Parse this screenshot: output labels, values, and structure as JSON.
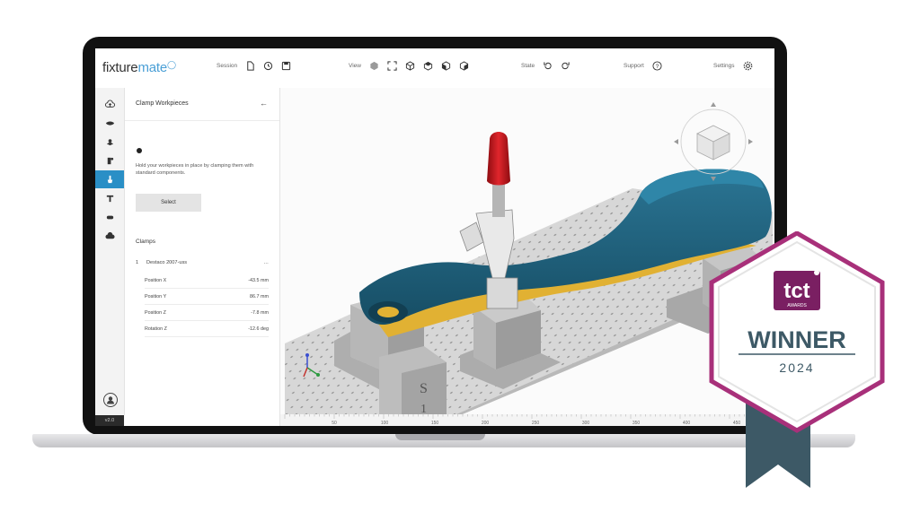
{
  "app": {
    "logo_main": "fixture",
    "logo_accent": "mate",
    "version": "v2.0"
  },
  "toolbar": {
    "session_label": "Session",
    "view_label": "View",
    "state_label": "State",
    "support_label": "Support",
    "settings_label": "Settings"
  },
  "panel": {
    "title": "Clamp Workpieces",
    "description": "Hold your workpieces in place by clamping them with standard components.",
    "select_label": "Select",
    "clamps_heading": "Clamps",
    "clamp": {
      "index": "1",
      "name": "Destaco 2007-uss",
      "more": "…"
    },
    "properties": [
      {
        "label": "Position X",
        "value": "-43.5 mm"
      },
      {
        "label": "Position Y",
        "value": "86.7 mm"
      },
      {
        "label": "Position Z",
        "value": "-7.8 mm"
      },
      {
        "label": "Rotation Z",
        "value": "-12.6 deg"
      }
    ]
  },
  "scene": {
    "ruler_ticks": [
      "50",
      "100",
      "150",
      "200",
      "250",
      "300",
      "350",
      "400",
      "450"
    ],
    "engraving_1": "S",
    "engraving_2": "1"
  },
  "badge": {
    "logo": "tct",
    "logo_sub": "AWARDS",
    "title": "WINNER",
    "year": "2024"
  },
  "colors": {
    "accent": "#2a8fc6",
    "workpiece": "#1f5f7a",
    "support": "#e1b133",
    "handle": "#c4151b",
    "badge_frame": "#a8307a",
    "ribbon": "#3d5966"
  }
}
